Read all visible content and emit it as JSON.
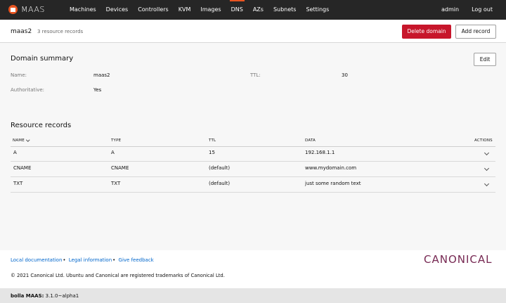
{
  "nav": {
    "logo_text": "MAAS",
    "items": [
      "Machines",
      "Devices",
      "Controllers",
      "KVM",
      "Images",
      "DNS",
      "AZs",
      "Subnets",
      "Settings"
    ],
    "active": "DNS",
    "right": [
      "admin",
      "Log out"
    ]
  },
  "header": {
    "domain": "maas2",
    "record_count": "3 resource records",
    "delete_label": "Delete domain",
    "add_label": "Add record"
  },
  "summary": {
    "title": "Domain summary",
    "edit_label": "Edit",
    "name_label": "Name:",
    "name_value": "maas2",
    "ttl_label": "TTL:",
    "ttl_value": "30",
    "auth_label": "Authoritative:",
    "auth_value": "Yes"
  },
  "records": {
    "title": "Resource records",
    "columns": [
      "NAME",
      "TYPE",
      "TTL",
      "DATA",
      "ACTIONS"
    ],
    "rows": [
      [
        "A",
        "A",
        "15",
        "192.168.1.1"
      ],
      [
        "CNAME",
        "CNAME",
        "(default)",
        "www.mydomain.com"
      ],
      [
        "TXT",
        "TXT",
        "(default)",
        "just some random text"
      ]
    ]
  },
  "footer": {
    "links": [
      "Local documentation",
      "Legal information",
      "Give feedback"
    ],
    "brand": "CANONICAL",
    "copyright": "© 2021 Canonical Ltd. Ubuntu and Canonical are registered trademarks of Canonical Ltd.",
    "status_host": "bolla MAAS:",
    "status_version": "3.1.0~alpha1"
  },
  "colors": {
    "accent": "#e95420",
    "danger": "#c7162b",
    "brand": "#772953",
    "nav_bg": "#262626"
  }
}
